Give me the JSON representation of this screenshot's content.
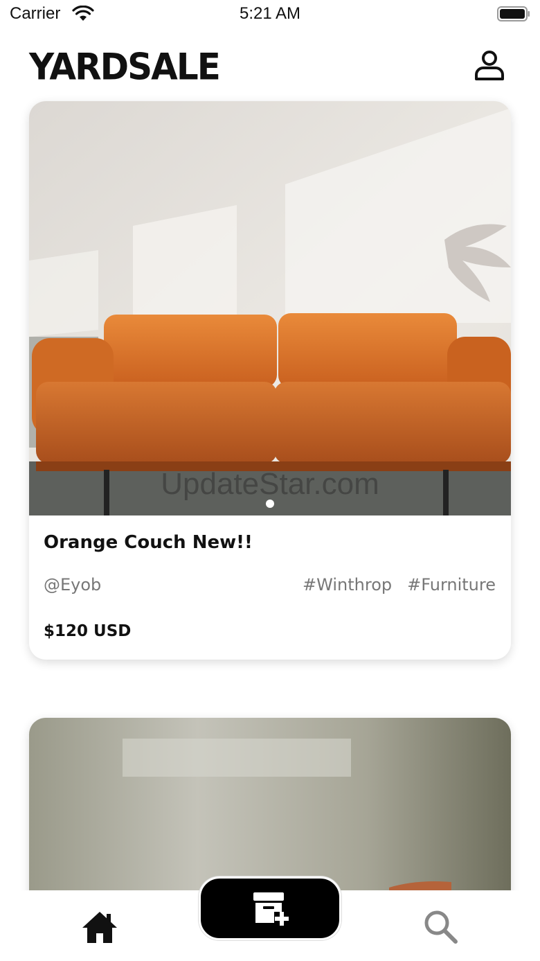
{
  "status_bar": {
    "carrier": "Carrier",
    "time": "5:21 AM",
    "icons": [
      "wifi-icon",
      "battery-icon"
    ]
  },
  "header": {
    "logo_text": "YARDSALE",
    "profile_icon": "person-icon"
  },
  "listings": [
    {
      "title": "Orange Couch New!!",
      "seller": "@Eyob",
      "tags": [
        "#Winthrop",
        "#Furniture"
      ],
      "price": "$120 USD",
      "image": "orange-leather-couch-photo",
      "watermark": "UpdateStar.com",
      "carousel": {
        "count": 1,
        "active": 0
      }
    },
    {
      "image": "second-listing-photo"
    }
  ],
  "tab_bar": {
    "items": [
      "home-icon",
      "post-listing-icon",
      "search-icon"
    ],
    "active": "home-icon"
  },
  "colors": {
    "background": "#ffffff",
    "text": "#111111",
    "muted": "#777777",
    "couch": "#d8742c",
    "post_button": "#000000",
    "inactive_tab": "#888888"
  }
}
